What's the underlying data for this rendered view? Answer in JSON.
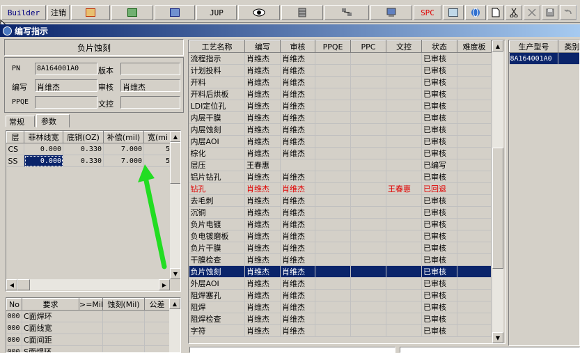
{
  "toolbar": {
    "builder": "Builder",
    "logout": "注销",
    "jup": "JUP",
    "spc": "SPC"
  },
  "window": {
    "title": "编写指示"
  },
  "left": {
    "heading": "负片蚀刻",
    "pn_label": "PN",
    "pn_value": "8A164001A0",
    "version_label": "版本",
    "author_label": "编写",
    "author_value": "肖维杰",
    "review_label": "审核",
    "review_value": "肖维杰",
    "ppqe_label": "PPQE",
    "doc_label": "文控",
    "tabs": [
      "常规",
      "参数"
    ],
    "param_columns": [
      "层",
      "菲林线宽",
      "底铜(OZ)",
      "补偿(mil)",
      "宽(mi"
    ],
    "param_rows": [
      [
        "CS",
        "0.000",
        "0.330",
        "7.000",
        "5"
      ],
      [
        "SS",
        "0.000",
        "0.330",
        "7.000",
        "5"
      ]
    ],
    "req_columns": [
      "No",
      "要求",
      ">=Mil",
      "蚀刻(Mil)",
      "公差"
    ],
    "req_rows": [
      [
        "000",
        "C面焊环"
      ],
      [
        "000",
        "C面线宽"
      ],
      [
        "000",
        "C面间距"
      ],
      [
        "000",
        "S面焊环"
      ]
    ]
  },
  "process": {
    "columns": [
      "工艺名称",
      "编写",
      "审核",
      "PPQE",
      "PPC",
      "文控",
      "状态",
      "难度板"
    ],
    "rows": [
      [
        "流程指示",
        "肖维杰",
        "肖维杰",
        "",
        "",
        "",
        "已审核"
      ],
      [
        "计划投料",
        "肖维杰",
        "肖维杰",
        "",
        "",
        "",
        "已审核"
      ],
      [
        "开料",
        "肖维杰",
        "肖维杰",
        "",
        "",
        "",
        "已审核"
      ],
      [
        "开料后烘板",
        "肖维杰",
        "肖维杰",
        "",
        "",
        "",
        "已审核"
      ],
      [
        "LDI定位孔",
        "肖维杰",
        "肖维杰",
        "",
        "",
        "",
        "已审核"
      ],
      [
        "内层干膜",
        "肖维杰",
        "肖维杰",
        "",
        "",
        "",
        "已审核"
      ],
      [
        "内层蚀刻",
        "肖维杰",
        "肖维杰",
        "",
        "",
        "",
        "已审核"
      ],
      [
        "内层AOI",
        "肖维杰",
        "肖维杰",
        "",
        "",
        "",
        "已审核"
      ],
      [
        "棕化",
        "肖维杰",
        "肖维杰",
        "",
        "",
        "",
        "已审核"
      ],
      [
        "层压",
        "王春惠",
        "",
        "",
        "",
        "",
        "已编写"
      ],
      [
        "铝片钻孔",
        "肖维杰",
        "肖维杰",
        "",
        "",
        "",
        "已审核"
      ],
      [
        "钻孔",
        "肖维杰",
        "肖维杰",
        "",
        "",
        "王春惠",
        "已回退"
      ],
      [
        "去毛刺",
        "肖维杰",
        "肖维杰",
        "",
        "",
        "",
        "已审核"
      ],
      [
        "沉铜",
        "肖维杰",
        "肖维杰",
        "",
        "",
        "",
        "已审核"
      ],
      [
        "负片电镀",
        "肖维杰",
        "肖维杰",
        "",
        "",
        "",
        "已审核"
      ],
      [
        "负电镀磨板",
        "肖维杰",
        "肖维杰",
        "",
        "",
        "",
        "已审核"
      ],
      [
        "负片干膜",
        "肖维杰",
        "肖维杰",
        "",
        "",
        "",
        "已审核"
      ],
      [
        "干膜检查",
        "肖维杰",
        "肖维杰",
        "",
        "",
        "",
        "已审核"
      ],
      [
        "负片蚀刻",
        "肖维杰",
        "肖维杰",
        "",
        "",
        "",
        "已审核"
      ],
      [
        "外层AOI",
        "肖维杰",
        "肖维杰",
        "",
        "",
        "",
        "已审核"
      ],
      [
        "阻焊塞孔",
        "肖维杰",
        "肖维杰",
        "",
        "",
        "",
        "已审核"
      ],
      [
        "阻焊",
        "肖维杰",
        "肖维杰",
        "",
        "",
        "",
        "已审核"
      ],
      [
        "阻焊检查",
        "肖维杰",
        "肖维杰",
        "",
        "",
        "",
        "已审核"
      ],
      [
        "字符",
        "肖维杰",
        "肖维杰",
        "",
        "",
        "",
        "已审核"
      ]
    ],
    "selected_row": 18,
    "red_row": 11
  },
  "right": {
    "columns": [
      "生产型号",
      "类别"
    ],
    "rows": [
      [
        "8A164001A0",
        ""
      ]
    ]
  },
  "colors": {
    "selection": "#0a246a",
    "red_text": "#e00000",
    "annotation_arrow": "#22dd22"
  }
}
